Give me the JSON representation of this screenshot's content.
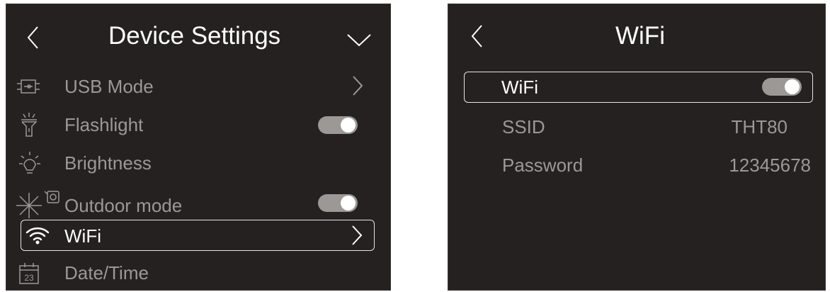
{
  "device_settings": {
    "title": "Device Settings",
    "items": [
      {
        "label": "USB Mode",
        "icon": "usb-icon",
        "control": "chevron"
      },
      {
        "label": "Flashlight",
        "icon": "flashlight-icon",
        "control": "toggle",
        "state": "on"
      },
      {
        "label": "Brightness",
        "icon": "brightness-icon",
        "control": "none"
      },
      {
        "label": "Outdoor mode",
        "icon": "outdoor-mode-icon",
        "control": "toggle",
        "state": "on"
      },
      {
        "label": "WiFi",
        "icon": "wifi-icon",
        "control": "chevron",
        "selected": true
      },
      {
        "label": "Date/Time",
        "icon": "calendar-icon",
        "calendar_day": "23",
        "control": "none"
      }
    ]
  },
  "wifi_settings": {
    "title": "WiFi",
    "rows": [
      {
        "label": "WiFi",
        "control": "toggle",
        "state": "on",
        "selected": true
      },
      {
        "label": "SSID",
        "value": "THT80"
      },
      {
        "label": "Password",
        "value": "12345678"
      }
    ]
  },
  "colors": {
    "background": "#242120",
    "selected_text": "#ffffff",
    "muted_text": "#9c9895",
    "toggle_track": "#9c9895",
    "toggle_knob": "#ffffff"
  }
}
